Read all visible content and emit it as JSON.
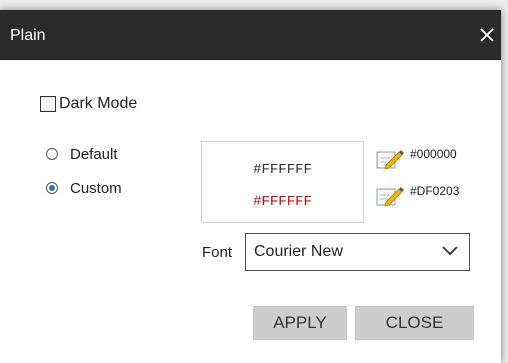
{
  "window": {
    "title": "Plain",
    "close_glyph": "X"
  },
  "options": {
    "dark_mode_label": "Dark Mode",
    "dark_mode_checked": false,
    "radio_default_label": "Default",
    "radio_custom_label": "Custom",
    "selected": "Custom"
  },
  "preview": {
    "line1_text": "#FFFFFF",
    "line1_color": "#333333",
    "line2_text": "#FFFFFF",
    "line2_color": "#DF0203"
  },
  "pickers": {
    "foreground_value": "#000000",
    "accent_value": "#DF0203"
  },
  "font": {
    "label": "Font",
    "selected": "Courier New"
  },
  "buttons": {
    "apply_label": "APPLY",
    "close_label": "CLOSE"
  },
  "colors": {
    "titlebar": "#2b2b2b",
    "button_bg": "#cdcdcd",
    "radio_accent": "#2a72c8"
  },
  "icons": {
    "picker_icon": "pencil-edit-icon",
    "close_icon": "close-icon",
    "dropdown_icon": "chevron-down-icon"
  }
}
